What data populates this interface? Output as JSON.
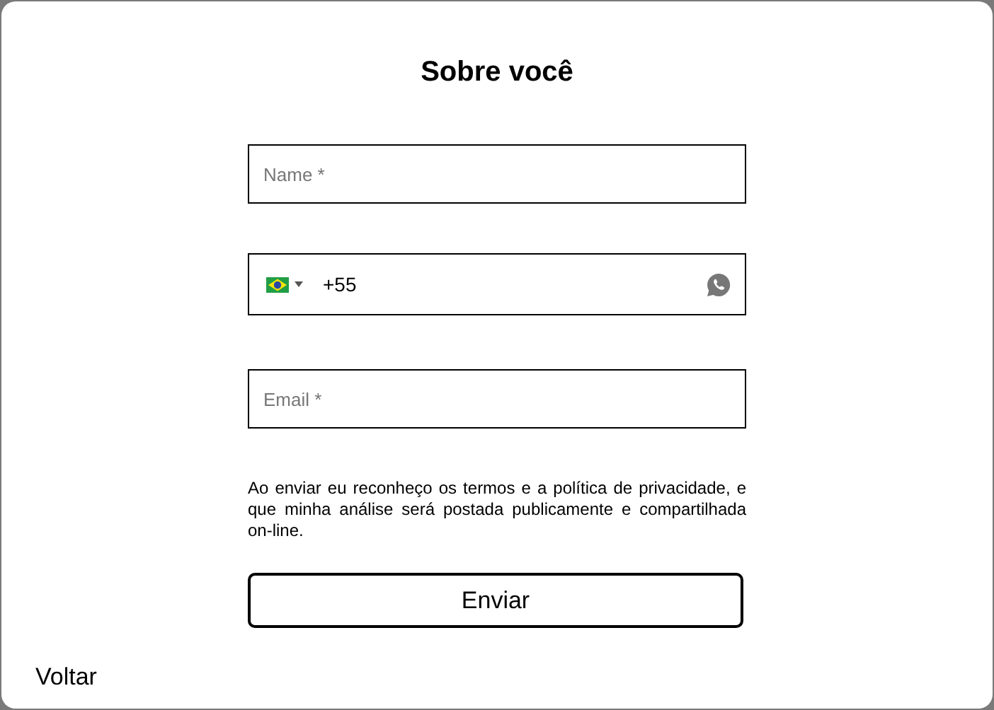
{
  "dialog": {
    "title": "Sobre você"
  },
  "fields": [
    {
      "kind": "text",
      "placeholder": "Name *"
    },
    {
      "kind": "phone",
      "value": "+55"
    },
    {
      "kind": "text",
      "placeholder": "Email *"
    }
  ],
  "disclaimer": "Ao enviar eu reconheço os termos e a política de privacidade, e que minha análise será postada publicamente e compartilhada on-line.",
  "submit_button": "Enviar",
  "back_link": "Voltar"
}
